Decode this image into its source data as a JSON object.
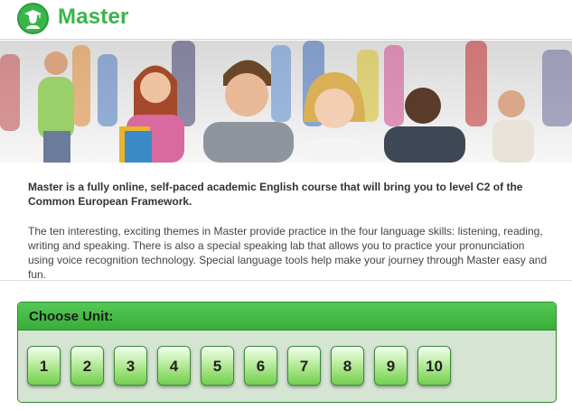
{
  "app": {
    "brand": "Master",
    "logo_icon": "student-icon"
  },
  "hero": {
    "image": "students-group-banner"
  },
  "content": {
    "intro": "Master is a fully online, self-paced academic English course that will bring you to level C2 of the Common European Framework.",
    "description": "The ten interesting, exciting themes in Master provide practice in the four language skills: listening, reading, writing and speaking. There is also a special speaking lab that allows you to practice your pronunciation using voice recognition technology. Special language tools help make your journey through Master easy and fun."
  },
  "unit_panel": {
    "title": "Choose Unit:",
    "units": [
      "1",
      "2",
      "3",
      "4",
      "5",
      "6",
      "7",
      "8",
      "9",
      "10"
    ]
  },
  "colors": {
    "brand_green": "#39b54a",
    "panel_header": "#44b844",
    "panel_background": "#d5e4d3"
  }
}
